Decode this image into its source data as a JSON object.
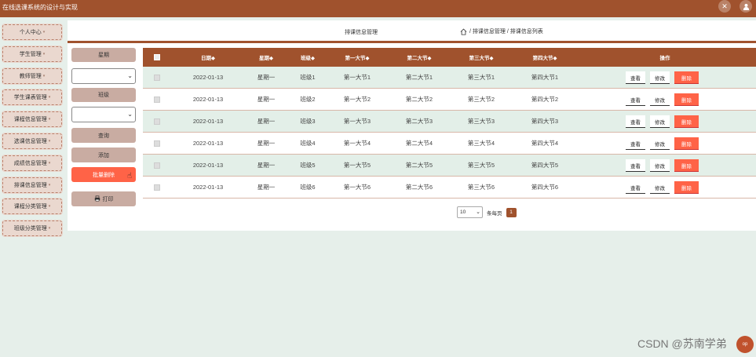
{
  "app": {
    "title": "在线选课系统的设计与实现"
  },
  "topbar": {
    "icons": [
      "expand-icon",
      "user-icon"
    ]
  },
  "sidebar": {
    "items": [
      {
        "label": "个人中心"
      },
      {
        "label": "学生管理"
      },
      {
        "label": "教师管理"
      },
      {
        "label": "学生课表管理"
      },
      {
        "label": "课程信息管理"
      },
      {
        "label": "选课信息管理"
      },
      {
        "label": "成绩信息管理"
      },
      {
        "label": "排课信息管理"
      },
      {
        "label": "课程分类管理"
      },
      {
        "label": "班级分类管理"
      }
    ],
    "caret": "▾"
  },
  "breadcrumb": {
    "title": "排课信息管理",
    "path": "/ 排课信息管理 / 排课信息列表"
  },
  "filters": {
    "weekday_label": "星期",
    "class_label": "班级",
    "search_label": "查询",
    "add_label": "添加",
    "batch_delete_label": "批量删除",
    "print_label": "打印"
  },
  "table": {
    "headers": [
      "日期◆",
      "星期◆",
      "班级◆",
      "第一大节◆",
      "第二大节◆",
      "第三大节◆",
      "第四大节◆",
      "操作"
    ],
    "rows": [
      {
        "date": "2022-01-13",
        "weekday": "星期一",
        "class": "班级1",
        "s1": "第一大节1",
        "s2": "第二大节1",
        "s3": "第三大节1",
        "s4": "第四大节1"
      },
      {
        "date": "2022-01-13",
        "weekday": "星期一",
        "class": "班级2",
        "s1": "第一大节2",
        "s2": "第二大节2",
        "s3": "第三大节2",
        "s4": "第四大节2"
      },
      {
        "date": "2022-01-13",
        "weekday": "星期一",
        "class": "班级3",
        "s1": "第一大节3",
        "s2": "第二大节3",
        "s3": "第三大节3",
        "s4": "第四大节3"
      },
      {
        "date": "2022-01-13",
        "weekday": "星期一",
        "class": "班级4",
        "s1": "第一大节4",
        "s2": "第二大节4",
        "s3": "第三大节4",
        "s4": "第四大节4"
      },
      {
        "date": "2022-01-13",
        "weekday": "星期一",
        "class": "班级5",
        "s1": "第一大节5",
        "s2": "第二大节5",
        "s3": "第三大节5",
        "s4": "第四大节5"
      },
      {
        "date": "2022-01-13",
        "weekday": "星期一",
        "class": "班级6",
        "s1": "第一大节6",
        "s2": "第二大节6",
        "s3": "第三大节6",
        "s4": "第四大节6"
      }
    ],
    "ops": {
      "view": "查看",
      "edit": "修改",
      "delete": "删除"
    }
  },
  "pager": {
    "page_size": "10",
    "per_page_label": "条每页",
    "current_page": "1"
  },
  "watermark": {
    "text": "CSDN @苏南学弟",
    "badge": "op"
  },
  "colors": {
    "brand": "#a0522d",
    "danger": "#ff6347",
    "row_alt": "#e3efe8"
  }
}
